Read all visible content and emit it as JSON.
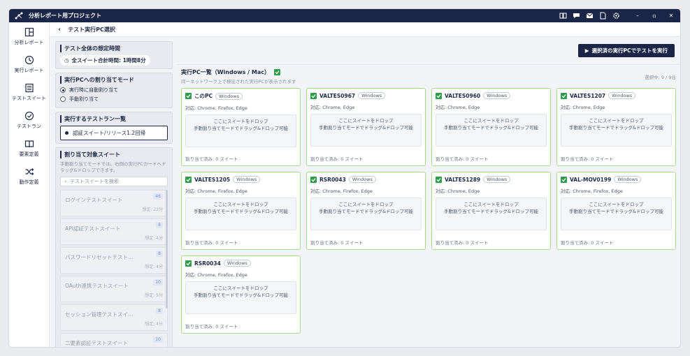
{
  "app": {
    "title": "分析レポート用プロジェクト"
  },
  "sidebar": {
    "items": [
      {
        "label": "分析レポート",
        "icon": "report-icon"
      },
      {
        "label": "実行レポート",
        "icon": "clock-icon"
      },
      {
        "label": "テストスイート",
        "icon": "suite-icon"
      },
      {
        "label": "テストラン",
        "icon": "run-icon"
      },
      {
        "label": "要素定義",
        "icon": "book-icon"
      },
      {
        "label": "動作定義",
        "icon": "shuffle-icon"
      }
    ]
  },
  "breadcrumb": {
    "title": "テスト実行PC選択"
  },
  "left": {
    "time_title": "テスト全体の想定時間",
    "time_value": "全スイート合計時間: 1時間8分",
    "mode_title": "実行PCへの割り当てモード",
    "mode_auto": "実行時に自動割り当て",
    "mode_manual": "手動割り当て",
    "run_title": "実行するテストラン一覧",
    "run_item": "認証スイート/リリース1.2回帰",
    "assign_title": "割り当て対象スイート",
    "assign_hint": "手動割り当てモードでは、右側の実行PCカードへドラッグ&ドロップできます。",
    "search_placeholder": "テストスイートを検索",
    "suites": [
      {
        "name": "ログインテストスイート",
        "count": "46",
        "est": "想定: 23分"
      },
      {
        "name": "API認証テストスイート",
        "count": "8",
        "est": "想定: 4分"
      },
      {
        "name": "パスワードリセットテスト…",
        "count": "8",
        "est": "想定: 4分"
      },
      {
        "name": "OAuth連携テストスイート",
        "count": "10",
        "est": "想定: 5分"
      },
      {
        "name": "セッション管理テストスイ…",
        "count": "8",
        "est": "想定: 4分"
      },
      {
        "name": "二要素認証テストスイート",
        "count": "10",
        "est": ""
      }
    ]
  },
  "right": {
    "run_button": "選択済の実行PCでテストを実行",
    "list_title": "実行PC一覧（Windows / Mac）",
    "list_sub": "同一ネットワーク上で検出された実行PCが表示されます",
    "selected": "選択中: 9 / 9台",
    "drop_line1": "ここにスイートをドロップ",
    "drop_line2": "手動割り当てモードでドラッグ&ドロップ可能",
    "assigned": "割り当て済み: 0 スイート",
    "pcs": [
      {
        "name": "このPC",
        "os": "Windows",
        "support": "対応: Chrome, Firefox, Edge"
      },
      {
        "name": "VALTES0967",
        "os": "Windows",
        "support": "対応: Chrome, Edge"
      },
      {
        "name": "VALTES0960",
        "os": "Windows",
        "support": "対応: Chrome, Edge"
      },
      {
        "name": "VALTES1207",
        "os": "Windows",
        "support": "対応: Chrome, Edge"
      },
      {
        "name": "VALTES1205",
        "os": "Windows",
        "support": "対応: Chrome, Firefox, Edge"
      },
      {
        "name": "RSR0043",
        "os": "Windows",
        "support": "対応: Chrome, Firefox, Edge"
      },
      {
        "name": "VALTES1289",
        "os": "Windows",
        "support": "対応: Chrome, Edge"
      },
      {
        "name": "VAL-MOV0199",
        "os": "Windows",
        "support": "対応: Chrome, Firefox, Edge"
      },
      {
        "name": "RSR0034",
        "os": "Windows",
        "support": "対応: Chrome, Firefox, Edge"
      }
    ]
  },
  "colors": {
    "accent": "#1a2547",
    "success": "#2e9c4b",
    "card_border": "#a8d98f"
  }
}
